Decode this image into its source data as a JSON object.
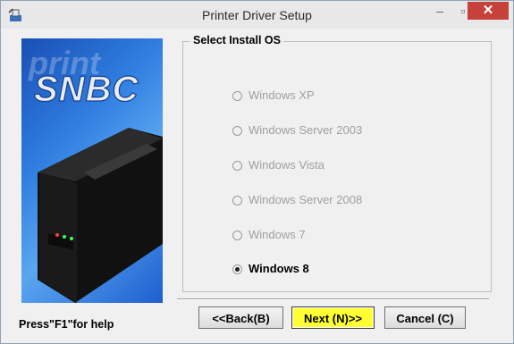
{
  "window": {
    "title": "Printer Driver Setup"
  },
  "banner": {
    "logo": "SNBC",
    "watermark": "print"
  },
  "group": {
    "title": "Select Install OS",
    "options": [
      {
        "label": "Windows XP",
        "enabled": false,
        "selected": false
      },
      {
        "label": "Windows Server 2003",
        "enabled": false,
        "selected": false
      },
      {
        "label": "Windows Vista",
        "enabled": false,
        "selected": false
      },
      {
        "label": "Windows Server 2008",
        "enabled": false,
        "selected": false
      },
      {
        "label": "Windows 7",
        "enabled": false,
        "selected": false
      },
      {
        "label": "Windows 8",
        "enabled": true,
        "selected": true
      }
    ]
  },
  "footer": {
    "help": "Press\"F1\"for help",
    "back": "<<Back(B)",
    "next": "Next (N)>>",
    "cancel": "Cancel (C)"
  },
  "colors": {
    "next_highlight": "#ffff33",
    "close_button": "#c7413b"
  }
}
